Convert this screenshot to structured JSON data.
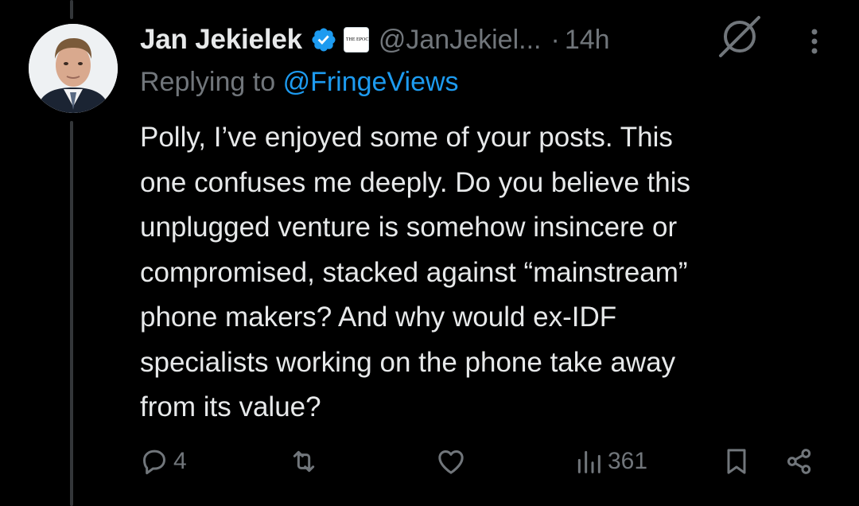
{
  "tweet": {
    "author": {
      "display_name": "Jan Jekielek",
      "handle": "@JanJekiel...",
      "affiliate_badge_text": "THE EPOCH TIMES",
      "avatar": "person-portrait"
    },
    "dot": "·",
    "time": "14h",
    "replying_to_label": "Replying to",
    "replying_to_handle": "@FringeViews",
    "text": "Polly, I’ve enjoyed some of your posts. This\none confuses me deeply. Do you believe this\nunplugged venture is somehow insincere or\ncompromised, stacked against “mainstream”\nphone makers? And why would ex-IDF\nspecialists working on the phone take away\nfrom its value?",
    "actions": {
      "reply_count": "4",
      "repost_count": "",
      "like_count": "",
      "view_count": "361"
    }
  },
  "colors": {
    "background": "#000000",
    "text": "#e7e9ea",
    "muted": "#71767b",
    "link": "#1d9bf0",
    "verified": "#1d9bf0",
    "thread_line": "#333639"
  },
  "icons": [
    "verified-badge-icon",
    "grok-icon",
    "more-icon",
    "reply-icon",
    "repost-icon",
    "like-icon",
    "views-icon",
    "bookmark-icon",
    "share-icon"
  ]
}
